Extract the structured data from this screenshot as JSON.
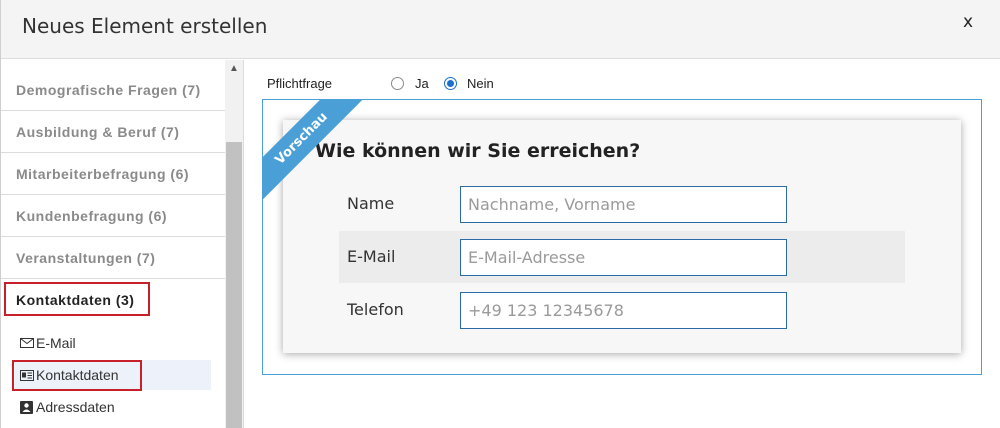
{
  "dialog": {
    "title": "Neues Element erstellen",
    "close_label": "x"
  },
  "sidebar": {
    "categories": [
      {
        "label": "Demografische Fragen (7)"
      },
      {
        "label": "Ausbildung & Beruf (7)"
      },
      {
        "label": "Mitarbeiterbefragung (6)"
      },
      {
        "label": "Kundenbefragung (6)"
      },
      {
        "label": "Veranstaltungen (7)"
      },
      {
        "label": "Kontaktdaten (3)",
        "active": true
      }
    ],
    "subitems": [
      {
        "label": "E-Mail",
        "icon": "envelope-icon"
      },
      {
        "label": "Kontaktdaten",
        "icon": "id-card-icon",
        "selected": true
      },
      {
        "label": "Adressdaten",
        "icon": "contact-book-icon"
      }
    ]
  },
  "required": {
    "label": "Pflichtfrage",
    "options": [
      "Ja",
      "Nein"
    ],
    "selected": "Nein"
  },
  "preview": {
    "ribbon": "Vorschau",
    "question": "Wie können wir Sie erreichen?",
    "rows": [
      {
        "label": "Name",
        "placeholder": "Nachname, Vorname"
      },
      {
        "label": "E-Mail",
        "placeholder": "E-Mail-Adresse"
      },
      {
        "label": "Telefon",
        "placeholder": "+49 123 12345678"
      }
    ]
  },
  "colors": {
    "accent": "#4a9fd6",
    "highlight": "#c8202a",
    "radio_checked": "#1a6fd1"
  }
}
